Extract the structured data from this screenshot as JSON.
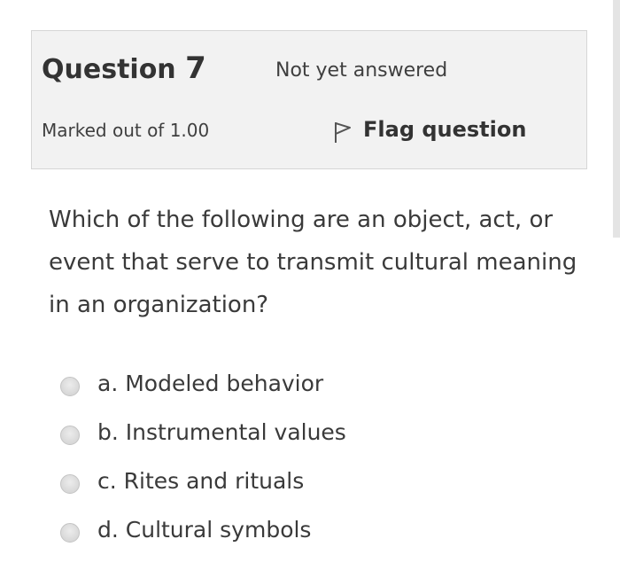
{
  "question": {
    "title_prefix": "Question",
    "number": "7",
    "state": "Not yet answered",
    "grade": "Marked out of 1.00",
    "flag_label": "Flag question",
    "flag_icon": "flag-icon",
    "text": "Which of the following are an object, act, or event that serve to transmit cultural meaning in an organization?"
  },
  "answers": [
    {
      "label": "a. Modeled behavior"
    },
    {
      "label": "b. Instrumental values"
    },
    {
      "label": "c. Rites and rituals"
    },
    {
      "label": "d. Cultural symbols"
    }
  ],
  "colors": {
    "info_background": "#f2f2f2",
    "info_border": "#d6d6d6",
    "text": "#3a3a3a"
  }
}
